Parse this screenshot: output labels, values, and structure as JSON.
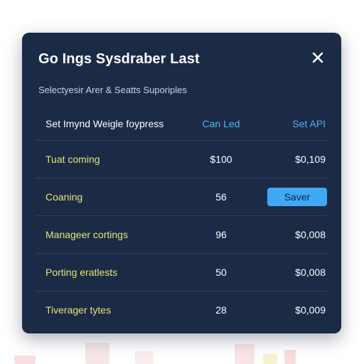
{
  "dialog": {
    "title": "Go Ings Sysdraber Last",
    "subtitle": "Selectyesir Arer & Seatts Suporiples"
  },
  "table": {
    "headers": [
      "Set Imynd Weigle foypress",
      "Can Led",
      "Set API"
    ],
    "rows": [
      {
        "name": "Tuat coming",
        "value": "$100",
        "amount": "$0,109"
      },
      {
        "name": "Coaning",
        "value": "56",
        "action": "Saver"
      },
      {
        "name": "Manageer cortings",
        "value": "96",
        "amount": "$0,008"
      },
      {
        "name": "Porting eratlests",
        "value": "50",
        "amount": "$0,008"
      },
      {
        "name": "Tiverager tytes",
        "value": "28",
        "amount": "$0,009"
      }
    ]
  },
  "colors": {
    "dialog_bg": "#1b2a45",
    "accent": "#3fa9f5",
    "row_label": "#e6e57a"
  },
  "icons": {
    "close": "close-icon"
  }
}
